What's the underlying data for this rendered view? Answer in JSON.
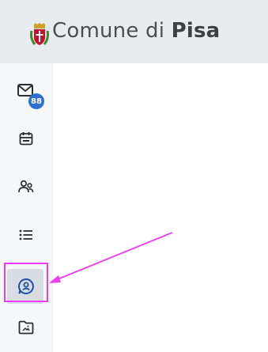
{
  "header": {
    "brand_prefix": "Comune di ",
    "brand_name": "Pisa",
    "logo_icon": "pisa-coat-of-arms-icon"
  },
  "sidebar": {
    "items": [
      {
        "id": "mail",
        "icon": "mail-icon",
        "badge": "88"
      },
      {
        "id": "calendar",
        "icon": "calendar-icon"
      },
      {
        "id": "users",
        "icon": "users-icon"
      },
      {
        "id": "list",
        "icon": "list-icon"
      },
      {
        "id": "support",
        "icon": "user-chat-icon",
        "selected": true
      },
      {
        "id": "files",
        "icon": "folder-image-icon"
      }
    ]
  },
  "annotation": {
    "highlight_color": "#f03cf0",
    "arrow_color": "#f03cf0"
  },
  "colors": {
    "header_bg": "#e9ecef",
    "sidebar_bg": "#f6f7f8",
    "badge_bg": "#2f6fd1",
    "selected_icon": "#1f4fa8"
  }
}
